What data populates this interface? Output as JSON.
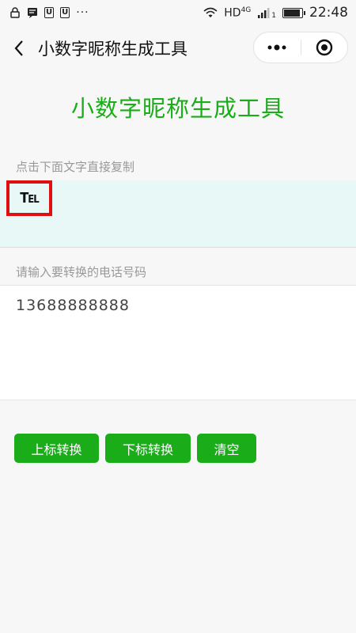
{
  "status_bar": {
    "network": "HD",
    "network_type": "4G",
    "signal_sub": "1",
    "time": "22:48",
    "more_dots": "···",
    "battery_level": 0.9
  },
  "nav": {
    "title": "小数字昵称生成工具"
  },
  "main": {
    "title": "小数字昵称生成工具",
    "copy_label": "点击下面文字直接复制",
    "copy_text": "Tel",
    "input_label": "请输入要转换的电话号码",
    "phone_value": "13688888888"
  },
  "buttons": {
    "superscript": "上标转换",
    "subscript": "下标转换",
    "clear": "清空"
  },
  "colors": {
    "accent": "#1aad19",
    "highlight_border": "#e01010",
    "copy_bg": "#e8f8f7"
  }
}
